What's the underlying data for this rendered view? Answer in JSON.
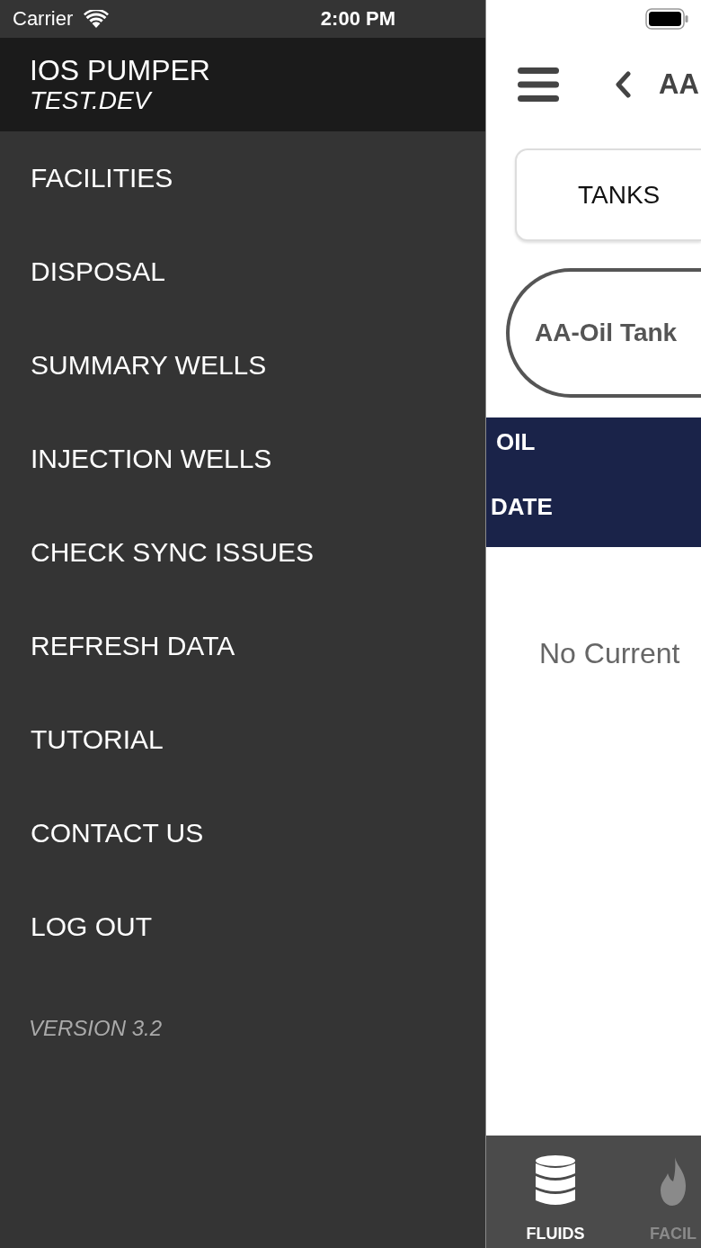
{
  "status_bar": {
    "carrier": "Carrier",
    "time": "2:00 PM"
  },
  "drawer": {
    "title": "IOS PUMPER",
    "subtitle": "TEST.DEV",
    "items": [
      "FACILITIES",
      "DISPOSAL",
      "SUMMARY WELLS",
      "INJECTION WELLS",
      "CHECK SYNC ISSUES",
      "REFRESH DATA",
      "TUTORIAL",
      "CONTACT US",
      "LOG OUT"
    ],
    "version": "VERSION 3.2"
  },
  "main": {
    "nav_title": "AA",
    "section_button": "TANKS",
    "tank_chip": "AA-Oil Tank",
    "table_header": {
      "row_1": "OIL",
      "row_2": "DATE"
    },
    "empty_message": "No Current"
  },
  "tab_bar": [
    {
      "label": "FLUIDS",
      "selected": true
    },
    {
      "label": "FACIL",
      "selected": false
    }
  ]
}
